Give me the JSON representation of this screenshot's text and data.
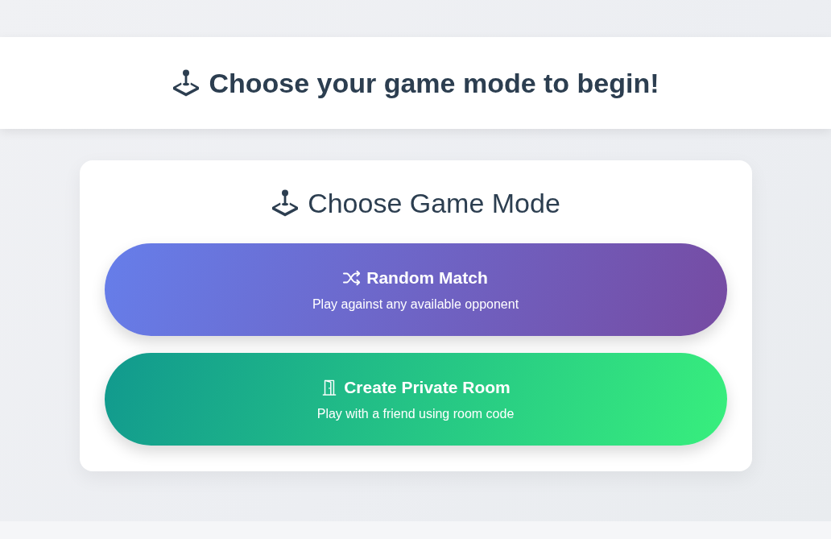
{
  "header": {
    "title": "Choose your game mode to begin!"
  },
  "mode_panel": {
    "title": "Choose Game Mode",
    "modes": [
      {
        "kind": "random",
        "title": "Random Match",
        "subtitle": "Play against any available opponent"
      },
      {
        "kind": "private",
        "title": "Create Private Room",
        "subtitle": "Play with a friend using room code"
      }
    ]
  }
}
